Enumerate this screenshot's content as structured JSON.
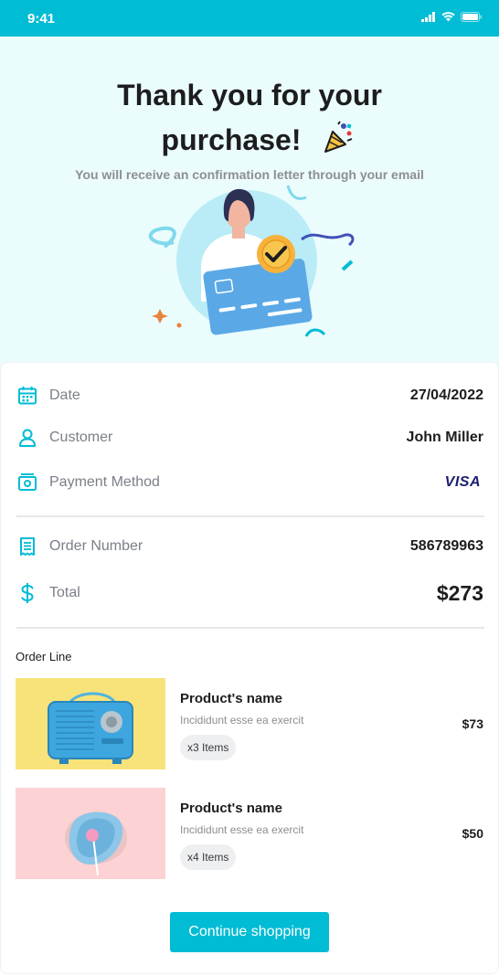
{
  "status": {
    "time": "9:41"
  },
  "hero": {
    "title_line1": "Thank you for your",
    "title_line2": "purchase!",
    "subtitle": "You will receive an confirmation letter through your email"
  },
  "details": {
    "date": {
      "label": "Date",
      "value": "27/04/2022",
      "icon": "calendar-icon"
    },
    "customer": {
      "label": "Customer",
      "value": "John Miller",
      "icon": "user-icon"
    },
    "payment": {
      "label": "Payment Method",
      "value": "VISA",
      "icon": "wallet-icon"
    },
    "order_number": {
      "label": "Order Number",
      "value": "586789963",
      "icon": "receipt-icon"
    },
    "total": {
      "label": "Total",
      "value": "$273",
      "icon": "dollar-icon"
    }
  },
  "order_line": {
    "title": "Order Line",
    "items": [
      {
        "name": "Product's name",
        "description": "Incididunt esse ea exercit",
        "quantity": "x3 Items",
        "price": "$73"
      },
      {
        "name": "Product's name",
        "description": "Incididunt esse ea exercit",
        "quantity": "x4 Items",
        "price": "$50"
      }
    ]
  },
  "continue_button": "Continue shopping",
  "colors": {
    "accent": "#00bcd4",
    "hero_bg": "#ebfcfd",
    "text_dark": "#1d1d1f",
    "text_muted": "#7b7f88"
  }
}
